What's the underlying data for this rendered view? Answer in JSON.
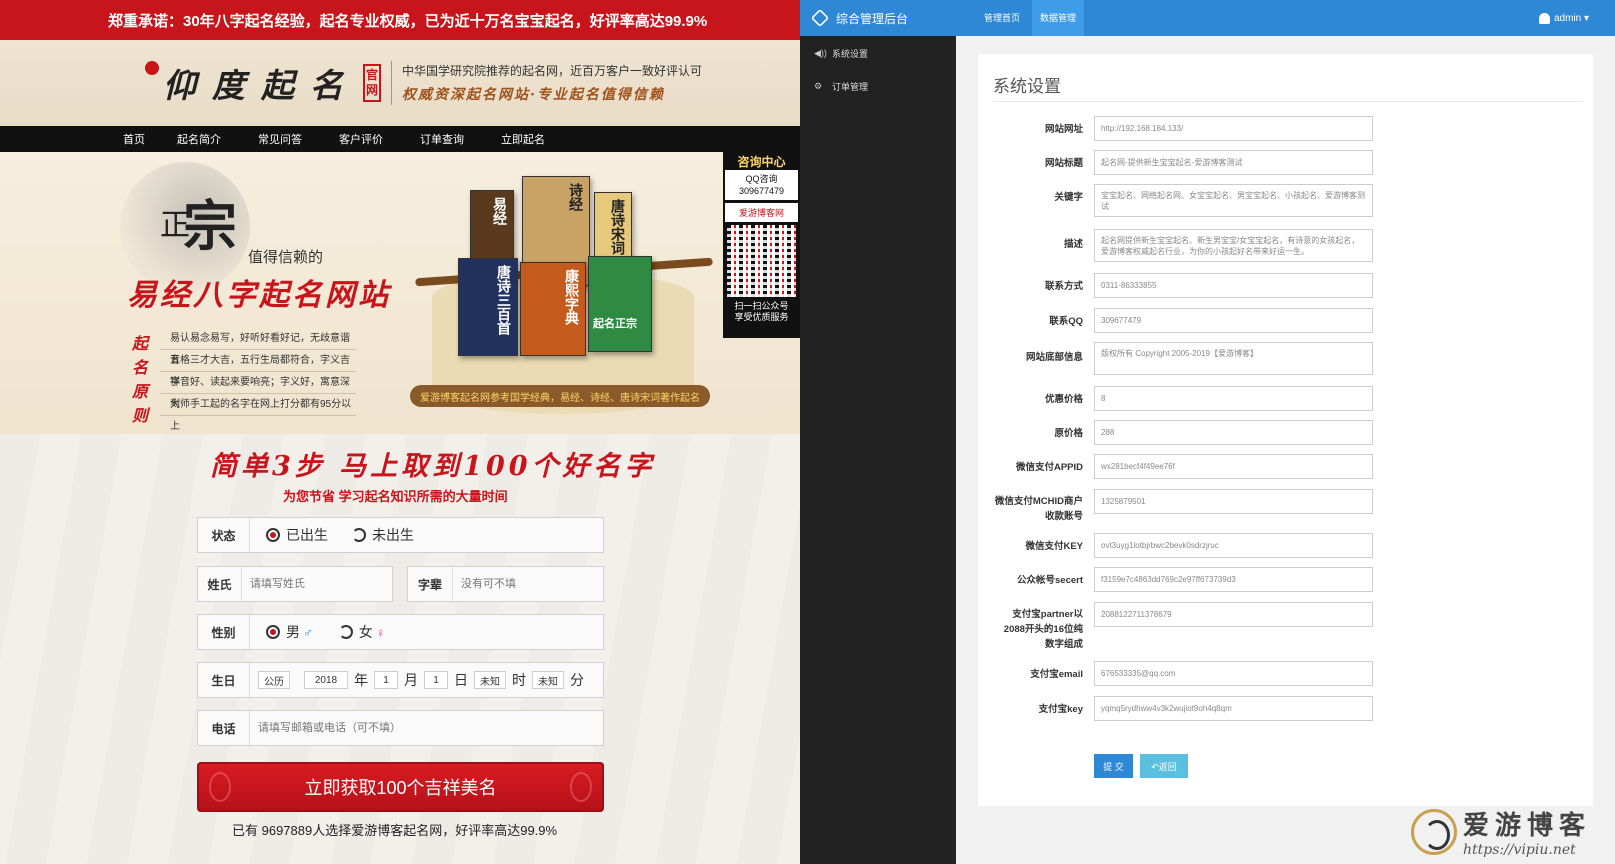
{
  "site": {
    "promo": "郑重承诺：30年八字起名经验，起名专业权威，已为近十万名宝宝起名，好评率高达99.9%",
    "logo_text": "仰度起名",
    "logo_seal": "官网",
    "slogan_line1": "中华国学研究院推荐的起名网，近百万客户一致好评认可",
    "slogan_line2": "权威资深起名网站·专业起名值得信赖",
    "nav": [
      "首页",
      "起名简介",
      "常见问答",
      "客户评价",
      "订单查询",
      "立即起名"
    ],
    "hero": {
      "zheng": "正",
      "zong": "宗",
      "trust": "值得信赖的",
      "site_name": "易经八字起名网站",
      "vertical": "起名原则",
      "principles": [
        "易认易念易写，好听好看好记，无歧意谐音",
        "五格三才大吉，五行生局都符合，字义吉祥",
        "字音好、读起来要响亮；字义好，寓意深刻",
        "大师手工起的名字在网上打分都有95分以上"
      ],
      "books": [
        "易经",
        "诗经",
        "唐诗宋词",
        "唐诗三百首",
        "康熙字典",
        "起名正宗"
      ],
      "caption": "爱游博客起名网参考国学经典，易经、诗经、唐诗宋词著作起名"
    },
    "side": {
      "title": "咨询中心",
      "qq_label": "QQ咨询",
      "qq_number": "309677479",
      "blog": "爱游博客网",
      "scan_line1": "扫一扫公众号",
      "scan_line2": "享受优质服务"
    },
    "form": {
      "steps_title": "简单3步 马上取到100个好名字",
      "steps_sub": "为您节省 学习起名知识所需的大量时间",
      "status_label": "状态",
      "status_born": "已出生",
      "status_unborn": "未出生",
      "surname_label": "姓氏",
      "surname_placeholder": "请填写姓氏",
      "generation_label": "字辈",
      "generation_placeholder": "没有可不填",
      "gender_label": "性别",
      "gender_male": "男",
      "gender_female": "女",
      "birth_label": "生日",
      "calendar": "公历",
      "year": "2018",
      "year_unit": "年",
      "month": "1",
      "month_unit": "月",
      "day": "1",
      "day_unit": "日",
      "hour": "未知",
      "hour_unit": "时",
      "minute": "未知",
      "minute_unit": "分",
      "phone_label": "电话",
      "phone_placeholder": "请填写邮箱或电话（可不填）",
      "cta": "立即获取100个吉祥美名",
      "count_text": "已有 9697889人选择爱游博客起名网，好评率高达99.9%"
    }
  },
  "admin": {
    "title": "综合管理后台",
    "tabs": [
      "管理首页",
      "数据管理"
    ],
    "user": "admin ▾",
    "sidebar": [
      {
        "icon": "◀))",
        "label": "系统设置"
      },
      {
        "icon": "⚙",
        "label": "订单管理"
      }
    ],
    "panel_title": "系统设置",
    "fields": [
      {
        "label": "网站网址",
        "value": "http://192.168.184.133/"
      },
      {
        "label": "网站标题",
        "value": "起名网-提供新生宝宝起名-爱游博客测试"
      },
      {
        "label": "关键字",
        "value": "宝宝起名、网络起名网、女宝宝起名、男宝宝起名、小孩起名、爱游博客测试"
      },
      {
        "label": "描述",
        "value": "起名网提供新生宝宝起名、新生男宝宝/女宝宝起名，有诗意的女孩起名，爱游博客权威起名行业，为你的小孩起好名带来好运一生。"
      },
      {
        "label": "联系方式",
        "value": "0311-86333855"
      },
      {
        "label": "联系QQ",
        "value": "309677479"
      },
      {
        "label": "网站底部信息",
        "value": "版权所有 Copyright 2005-2019【爱游博客】"
      },
      {
        "label": "优惠价格",
        "value": "8"
      },
      {
        "label": "原价格",
        "value": "288"
      },
      {
        "label": "微信支付APPID",
        "value": "wx281becf4f49ee76f"
      },
      {
        "label": "微信支付MCHID商户收款账号",
        "value": "1325879501"
      },
      {
        "label": "微信支付KEY",
        "value": "ovt3uyg1lotbjrbwc2bevk0sdrzjruc"
      },
      {
        "label": "公众帐号secert",
        "value": "f3159e7c4863dd769c2e97ff673739d3"
      },
      {
        "label": "支付宝partner以2088开头的16位纯数字组成",
        "value": "2088122711378679"
      },
      {
        "label": "支付宝email",
        "value": "676533335@qq.com"
      },
      {
        "label": "支付宝key",
        "value": "yqmq5rydhww4v3k2wujiot9oh4q8qm"
      }
    ],
    "submit": "提 交",
    "back": "↶返回"
  },
  "watermark": {
    "text1": "爱游博客",
    "text2": "https://vipiu.net"
  }
}
